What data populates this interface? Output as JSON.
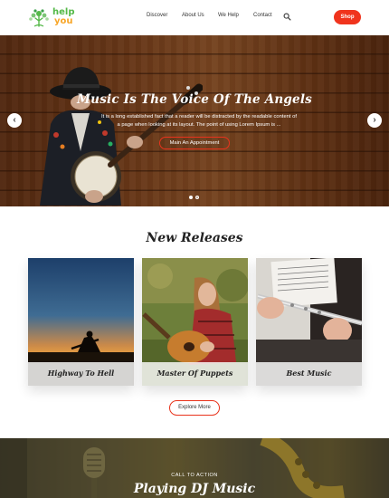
{
  "header": {
    "logo": {
      "line1": "help",
      "line2": "you"
    },
    "nav": [
      "Discover",
      "About Us",
      "We Help",
      "Contact"
    ],
    "search_icon": "search-icon",
    "shop_label": "Shop"
  },
  "hero": {
    "title": "Music Is The Voice Of The Angels",
    "description": "It is a long established fact that a reader will be distracted by the readable content of a page when looking at its layout. The point of using Lorem Ipsum is ...",
    "button_label": "Main An Appointment",
    "prev_icon": "chevron-left-icon",
    "next_icon": "chevron-right-icon",
    "slides_total": 2,
    "active_slide": 1
  },
  "releases": {
    "title": "New Releases",
    "cards": [
      {
        "label": "Highway To Hell"
      },
      {
        "label": "Master Of Puppets"
      },
      {
        "label": "Best Music"
      }
    ],
    "explore_label": "Explore More"
  },
  "cta": {
    "kicker": "CALL TO ACTION",
    "title": "Playing DJ Music"
  },
  "colors": {
    "accent": "#f0341d",
    "logo_green": "#54b948",
    "logo_orange": "#f7a629"
  }
}
